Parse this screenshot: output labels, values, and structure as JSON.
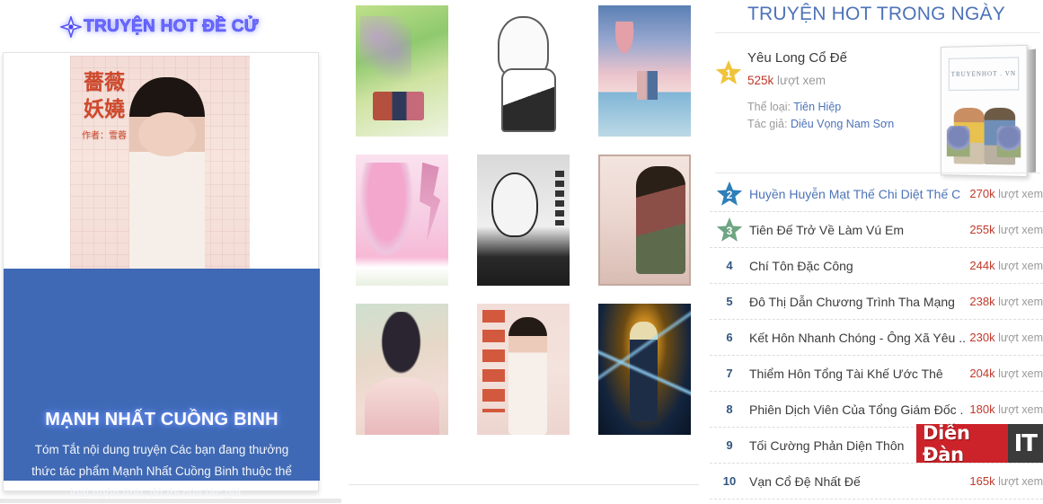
{
  "promo": {
    "header_icon": "diamond-star-icon",
    "header_title": "TRUYỆN HOT ĐỀ CỬ",
    "book_title": "MẠNH NHẤT CUỒNG BINH",
    "description": "Tóm Tắt nội dung truyện Các bạn đang thưởng thức tác phẩm Mạnh Nhất Cuồng Binh thuộc thể loại ngôn tình, đô thị của tác giả…",
    "cover_cjk": "薔薇妖嬈",
    "cover_cjk_sub": "作者：雪蓉"
  },
  "thumbnails": [
    {
      "alt": "garden-couple-cover",
      "art": "t-garden"
    },
    {
      "alt": "lineart-manga-cover",
      "art": "t-lineart"
    },
    {
      "alt": "beach-sunset-cover",
      "art": "t-beach"
    },
    {
      "alt": "pink-anime-girl-cover",
      "art": "t-pinkgirl"
    },
    {
      "alt": "chinese-meme-cover",
      "art": "t-meme"
    },
    {
      "alt": "ancient-couple-cover",
      "art": "t-couple"
    },
    {
      "alt": "hanfu-woman-cover",
      "art": "t-hanfu"
    },
    {
      "alt": "rose-beauty-cover",
      "art": "t-pinkgirl2"
    },
    {
      "alt": "lightning-wizard-cover",
      "art": "t-wizard"
    }
  ],
  "ranking": {
    "title": "TRUYỆN HOT TRONG NGÀY",
    "views_suffix": "lượt xem",
    "featured": {
      "rank": "1",
      "name": "Yêu Long Cổ Đế",
      "views": "525k",
      "views_suffix": "lượt xem",
      "genre_label": "Thể loại:",
      "genre": "Tiên Hiệp",
      "author_label": "Tác giả:",
      "author": "Diêu Vọng Nam Sơn",
      "book_cover_text": "TRUYENHOT . VN"
    },
    "rows": [
      {
        "rank": "2",
        "name": "Huyền Huyễn Mạt Thế Chi Diệt Thế C",
        "views": "270k",
        "badge": "star-blue"
      },
      {
        "rank": "3",
        "name": "Tiên Đế Trở Về Làm Vú Em",
        "views": "255k",
        "badge": "star-green"
      },
      {
        "rank": "4",
        "name": "Chí Tôn Đặc Công",
        "views": "244k",
        "badge": "number"
      },
      {
        "rank": "5",
        "name": "Đô Thị Dẫn Chương Trình Tha Mạng",
        "views": "238k",
        "badge": "number"
      },
      {
        "rank": "6",
        "name": "Kết Hôn Nhanh Chóng - Ông Xã Yêu ..",
        "views": "230k",
        "badge": "number"
      },
      {
        "rank": "7",
        "name": "Thiểm Hôn Tổng Tài Khế Ước Thê",
        "views": "204k",
        "badge": "number"
      },
      {
        "rank": "8",
        "name": "Phiên Dịch Viên Của Tổng Giám Đốc .",
        "views": "180k",
        "badge": "number"
      },
      {
        "rank": "9",
        "name": "Tối Cường Phản Diện Thôn",
        "views": "",
        "badge": "number"
      },
      {
        "rank": "10",
        "name": "Vạn Cổ Đệ Nhất Đế",
        "views": "165k",
        "badge": "number"
      }
    ]
  },
  "watermark": {
    "left_text": "Diễn Đàn",
    "right_text": "IT"
  },
  "colors": {
    "promo_panel": "#3f69b4",
    "heading_blue": "#4c73b8",
    "views_red": "#c0392b",
    "star_gold": "#f0c33c",
    "star_blue": "#2e7fb8",
    "star_green": "#6fa583",
    "watermark_red": "#cc2229",
    "watermark_dark": "#3b3b3b"
  }
}
